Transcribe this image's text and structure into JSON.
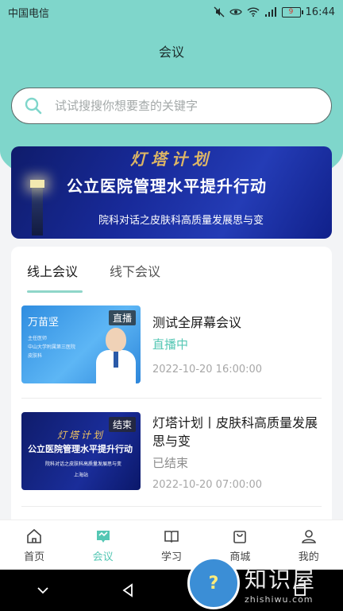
{
  "status_bar": {
    "carrier": "中国电信",
    "battery": "9",
    "time": "16:44"
  },
  "header": {
    "title": "会议"
  },
  "search": {
    "placeholder": "试试搜搜你想要查的关键字"
  },
  "banner": {
    "top_text": "灯塔计划",
    "title": "公立医院管理水平提升行动",
    "subtitle": "院科对话之皮肤科高质量发展思与变"
  },
  "tabs": [
    {
      "label": "线上会议",
      "active": true
    },
    {
      "label": "线下会议",
      "active": false
    }
  ],
  "meetings": [
    {
      "thumb_name": "万苗坚",
      "thumb_info": [
        "主任医师",
        "中山大学附属第三医院",
        "皮肤科"
      ],
      "badge": "直播",
      "title": "测试全屏幕会议",
      "status": "直播中",
      "time": "2022-10-20 16:00:00"
    },
    {
      "thumb_top": "灯塔计划",
      "thumb_title": "公立医院管理水平提升行动",
      "thumb_sub": "院科对话之皮肤科高质量发展思与变",
      "thumb_loc": "上海站",
      "badge": "结束",
      "title": "灯塔计划丨皮肤科高质量发展思与变",
      "status": "已结束",
      "time": "2022-10-20 07:00:00"
    }
  ],
  "bottom_nav": [
    {
      "label": "首页",
      "icon": "home-icon"
    },
    {
      "label": "会议",
      "icon": "meeting-icon",
      "active": true
    },
    {
      "label": "学习",
      "icon": "book-icon"
    },
    {
      "label": "商城",
      "icon": "shopping-bag-icon"
    },
    {
      "label": "我的",
      "icon": "profile-icon"
    }
  ],
  "watermark": {
    "main": "知识屋",
    "sub": "zhishiwu.com",
    "mark": "?"
  },
  "colors": {
    "accent": "#55c7b4",
    "header_bg": "#7fd6cb"
  }
}
